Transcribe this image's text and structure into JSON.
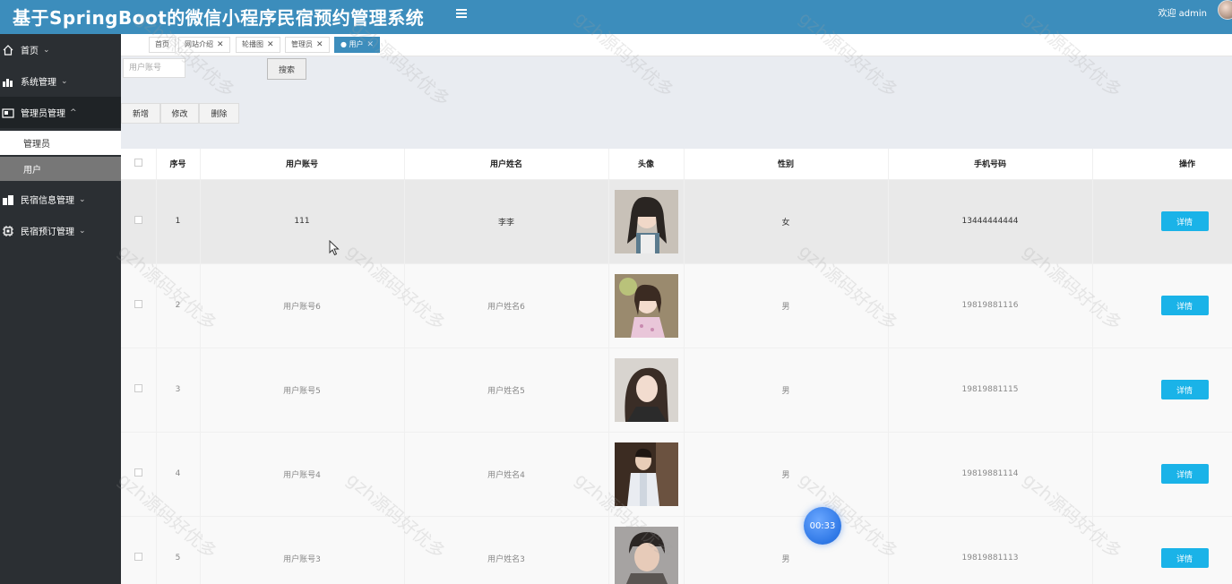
{
  "header": {
    "title": "基于SpringBoot的微信小程序民宿预约管理系统",
    "welcome": "欢迎 admin"
  },
  "sidebar": {
    "items": [
      {
        "label": "首页",
        "icon": "home-icon"
      },
      {
        "label": "系统管理",
        "icon": "chart-icon"
      },
      {
        "label": "管理员管理",
        "icon": "id-card-icon",
        "expanded": true
      },
      {
        "label": "民宿信息管理",
        "icon": "building-icon"
      },
      {
        "label": "民宿预订管理",
        "icon": "chip-icon"
      }
    ],
    "subitems": [
      {
        "label": "管理员"
      },
      {
        "label": "用户"
      }
    ]
  },
  "tabs": [
    {
      "label": "首页",
      "closable": false
    },
    {
      "label": "网站介绍",
      "closable": true
    },
    {
      "label": "轮播图",
      "closable": true
    },
    {
      "label": "管理员",
      "closable": true
    },
    {
      "label": "● 用户",
      "closable": true,
      "active": true
    }
  ],
  "toolbar": {
    "search_placeholder": "用户账号",
    "search_label": "搜索",
    "add_label": "新增",
    "edit_label": "修改",
    "delete_label": "删除"
  },
  "table": {
    "headers": [
      "",
      "序号",
      "用户账号",
      "用户姓名",
      "头像",
      "性别",
      "手机号码",
      "操作"
    ],
    "action_label": "详情",
    "rows": [
      {
        "index": "1",
        "account": "111",
        "name": "李李",
        "gender": "女",
        "phone": "13444444444"
      },
      {
        "index": "2",
        "account": "用户账号6",
        "name": "用户姓名6",
        "gender": "男",
        "phone": "19819881116"
      },
      {
        "index": "3",
        "account": "用户账号5",
        "name": "用户姓名5",
        "gender": "男",
        "phone": "19819881115"
      },
      {
        "index": "4",
        "account": "用户账号4",
        "name": "用户姓名4",
        "gender": "男",
        "phone": "19819881114"
      },
      {
        "index": "5",
        "account": "用户账号3",
        "name": "用户姓名3",
        "gender": "男",
        "phone": "19819881113"
      }
    ]
  },
  "timer": "00:33",
  "watermark": "gzh源码好优多",
  "colors": {
    "header": "#3c8dbc",
    "sidebar": "#2b2f33",
    "detail_button": "#1ab3e8"
  }
}
